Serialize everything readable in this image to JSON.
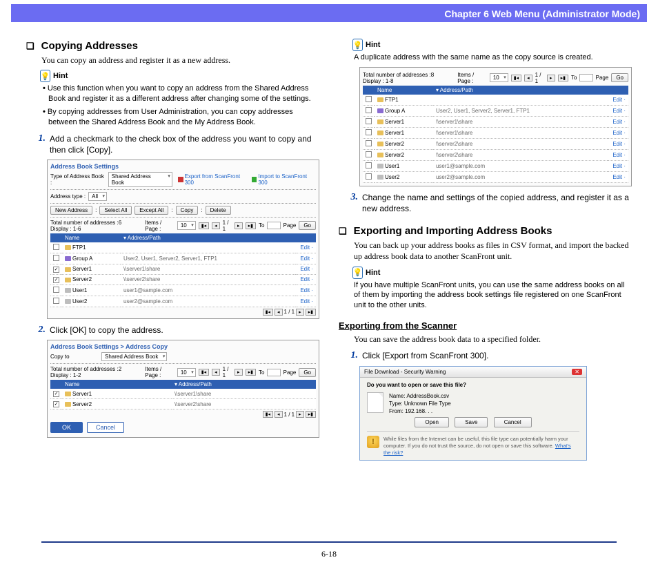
{
  "header": {
    "chapter": "Chapter 6   Web Menu (Administrator Mode)"
  },
  "left": {
    "sec1_title": "Copying Addresses",
    "sec1_intro": "You can copy an address and register it as a new address.",
    "hint_label": "Hint",
    "hint_b1": "Use this function when you want to copy an address from the Shared Address Book and register it as a different address after changing some of the settings.",
    "hint_b2": "By copying addresses from User Administration, you can copy addresses between the Shared Address Book and the My Address Book.",
    "step1": "Add a checkmark to the check box of the address you want to copy and then click [Copy].",
    "step2": "Click [OK] to copy the address.",
    "fig1": {
      "title": "Address Book Settings",
      "type_label": "Type of Address Book :",
      "type_value": "Shared Address Book",
      "export_link": "Export from ScanFront 300",
      "import_link": "Import to ScanFront 300",
      "addrtype_label": "Address type :",
      "addrtype_value": "All",
      "btns": {
        "new": "New Address",
        "selall": "Select All",
        "exall": "Except All",
        "copy": "Copy",
        "del": "Delete"
      },
      "countline_a": "Total number of addresses :6 Display : 1-6",
      "countline_b": "Items / Page :",
      "per_page": "10",
      "pager_mid": "1 / 1",
      "to_label": "To",
      "page_label": "Page",
      "go": "Go",
      "th_name": "Name",
      "th_addr": "Address/Path",
      "edit": "Edit",
      "rows": [
        {
          "chk": false,
          "icon": "ftp",
          "name": "FTP1",
          "addr": ""
        },
        {
          "chk": false,
          "icon": "grp",
          "name": "Group A",
          "addr": "User2, User1, Server2, Server1, FTP1"
        },
        {
          "chk": true,
          "icon": "fld",
          "name": "Server1",
          "addr": "\\\\server1\\share"
        },
        {
          "chk": true,
          "icon": "fld",
          "name": "Server2",
          "addr": "\\\\server2\\share"
        },
        {
          "chk": false,
          "icon": "usr",
          "name": "User1",
          "addr": "user1@sample.com"
        },
        {
          "chk": false,
          "icon": "usr",
          "name": "User2",
          "addr": "user2@sample.com"
        }
      ]
    },
    "fig2": {
      "title": "Address Book Settings > Address Copy",
      "copyto_label": "Copy to",
      "copyto_value": "Shared Address Book",
      "countline_a": "Total number of addresses :2 Display : 1-2",
      "countline_b": "Items / Page :",
      "per_page": "10",
      "pager_mid": "1 / 1",
      "to_label": "To",
      "page_label": "Page",
      "go": "Go",
      "th_name": "Name",
      "th_addr": "Address/Path",
      "rows": [
        {
          "chk": true,
          "name": "Server1",
          "addr": "\\\\server1\\share"
        },
        {
          "chk": true,
          "name": "Server2",
          "addr": "\\\\server2\\share"
        }
      ],
      "ok": "OK",
      "cancel": "Cancel"
    }
  },
  "right": {
    "hint_label": "Hint",
    "top_hint": "A duplicate address with the same name as the copy source is created.",
    "fig3": {
      "countline_a": "Total number of addresses :8 Display : 1-8",
      "countline_b": "Items / Page :",
      "per_page": "10",
      "pager_mid": "1 / 1",
      "to_label": "To",
      "page_label": "Page",
      "go": "Go",
      "th_name": "Name",
      "th_addr": "Address/Path",
      "edit": "Edit",
      "rows": [
        {
          "icon": "ftp",
          "name": "FTP1",
          "addr": ""
        },
        {
          "icon": "grp",
          "name": "Group A",
          "addr": "User2, User1, Server2, Server1, FTP1"
        },
        {
          "icon": "fld",
          "name": "Server1",
          "addr": "\\\\server1\\share"
        },
        {
          "icon": "fld",
          "name": "Server1",
          "addr": "\\\\server1\\share"
        },
        {
          "icon": "fld",
          "name": "Server2",
          "addr": "\\\\server2\\share"
        },
        {
          "icon": "fld",
          "name": "Server2",
          "addr": "\\\\server2\\share"
        },
        {
          "icon": "usr",
          "name": "User1",
          "addr": "user1@sample.com"
        },
        {
          "icon": "usr",
          "name": "User2",
          "addr": "user2@sample.com"
        }
      ]
    },
    "step3": "Change the name and settings of the copied address, and register it as a new address.",
    "sec2_title": "Exporting and Importing Address Books",
    "sec2_intro": "You can back up your address books as files in CSV format, and import the backed up address book data to another ScanFront unit.",
    "sec2_hint": "If you have multiple ScanFront units, you can use the same address books on all of them by importing the address book settings file registered on one ScanFront unit to the other units.",
    "sub_title": "Exporting from the Scanner",
    "sub_intro": "You can save the address book data to a specified folder.",
    "sub_step1": "Click [Export from ScanFront 300].",
    "dlg": {
      "title": "File Download - Security Warning",
      "close": "✕",
      "question": "Do you want to open or save this file?",
      "name_label": "Name:",
      "name_value": "AddressBook.csv",
      "type_label": "Type:",
      "type_value": "Unknown File Type",
      "from_label": "From:",
      "from_value": "192.168. . .",
      "open": "Open",
      "save": "Save",
      "cancel": "Cancel",
      "warn": "While files from the Internet can be useful, this file type can potentially harm your computer. If you do not trust the source, do not open or save this software. ",
      "warn_link": "What's the risk?"
    }
  },
  "footer": {
    "page": "6-18"
  }
}
